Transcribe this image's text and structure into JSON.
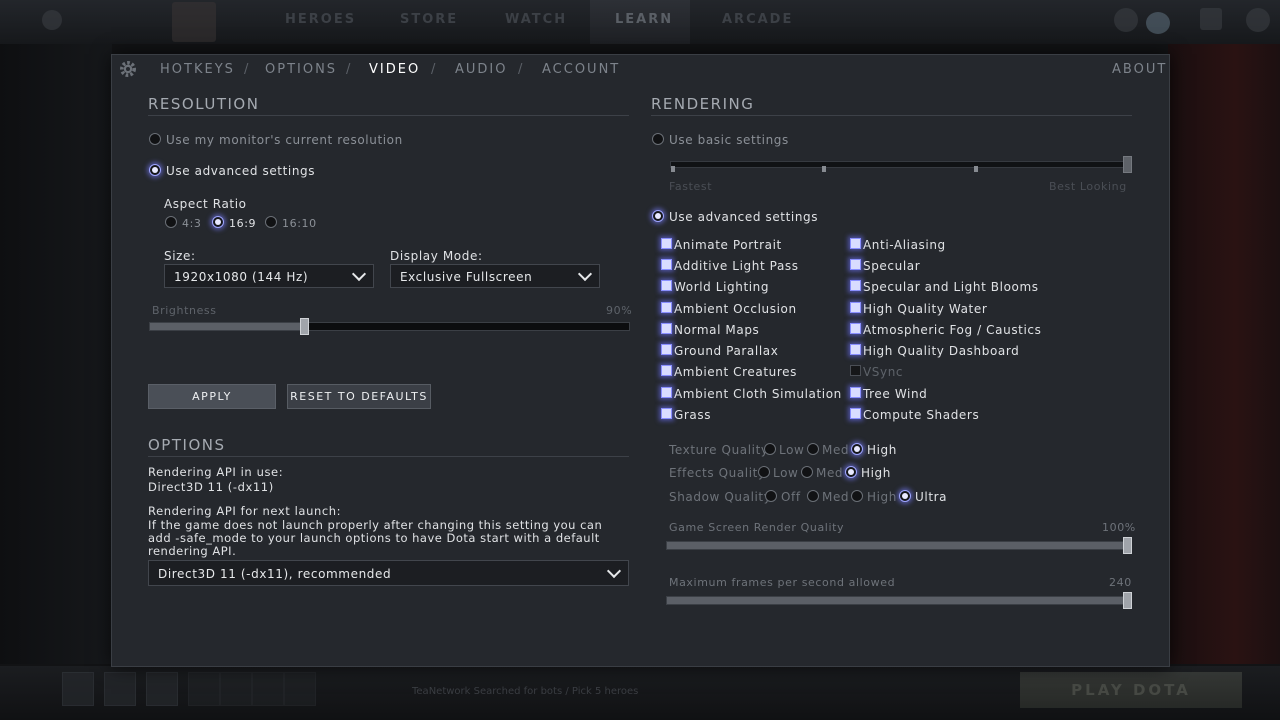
{
  "background": {
    "nav": [
      "HEROES",
      "STORE",
      "WATCH",
      "LEARN",
      "ARCADE"
    ],
    "play_label": "PLAY DOTA",
    "status_text": "TeaNetwork   Searched for bots / Pick 5 heroes"
  },
  "tabs": [
    {
      "label": "HOTKEYS"
    },
    {
      "label": "OPTIONS"
    },
    {
      "label": "VIDEO"
    },
    {
      "label": "AUDIO"
    },
    {
      "label": "ACCOUNT"
    }
  ],
  "tab_separator": "/",
  "about_label": "ABOUT",
  "resolution": {
    "title": "RESOLUTION",
    "use_monitor": "Use my monitor's current resolution",
    "use_advanced": "Use advanced settings",
    "aspect_ratio_label": "Aspect Ratio",
    "aspect_options": [
      "4:3",
      "16:9",
      "16:10"
    ],
    "aspect_selected": "16:9",
    "size_label": "Size:",
    "size_value": "1920x1080 (144 Hz)",
    "display_mode_label": "Display Mode:",
    "display_mode_value": "Exclusive Fullscreen",
    "brightness_label": "Brightness",
    "brightness_value": "90%",
    "brightness_level": 0.33,
    "apply_label": "APPLY",
    "reset_label": "RESET TO DEFAULTS"
  },
  "options": {
    "title": "OPTIONS",
    "api_in_use_label": "Rendering API in use:",
    "api_in_use_value": "Direct3D 11 (-dx11)",
    "api_next_label": "Rendering API for next launch:",
    "api_note_1": "If the game does not launch properly after changing this setting you can",
    "api_note_2": "add -safe_mode to your launch options to have Dota start with a default",
    "api_note_3": "rendering API.",
    "api_dropdown_value": "Direct3D 11 (-dx11), recommended"
  },
  "rendering": {
    "title": "RENDERING",
    "use_basic": "Use basic settings",
    "basic_min_label": "Fastest",
    "basic_max_label": "Best Looking",
    "use_advanced": "Use advanced settings",
    "left_checks": [
      {
        "label": "Animate Portrait",
        "checked": true
      },
      {
        "label": "Additive Light Pass",
        "checked": true
      },
      {
        "label": "World Lighting",
        "checked": true
      },
      {
        "label": "Ambient Occlusion",
        "checked": true
      },
      {
        "label": "Normal Maps",
        "checked": true
      },
      {
        "label": "Ground Parallax",
        "checked": true
      },
      {
        "label": "Ambient Creatures",
        "checked": true
      },
      {
        "label": "Ambient Cloth Simulation",
        "checked": true
      },
      {
        "label": "Grass",
        "checked": true
      }
    ],
    "right_checks": [
      {
        "label": "Anti-Aliasing",
        "checked": true
      },
      {
        "label": "Specular",
        "checked": true
      },
      {
        "label": "Specular and Light Blooms",
        "checked": true
      },
      {
        "label": "High Quality Water",
        "checked": true
      },
      {
        "label": "Atmospheric Fog / Caustics",
        "checked": true
      },
      {
        "label": "High Quality Dashboard",
        "checked": true
      },
      {
        "label": "VSync",
        "checked": false
      },
      {
        "label": "Tree Wind",
        "checked": true
      },
      {
        "label": "Compute Shaders",
        "checked": true
      }
    ],
    "texture_quality": {
      "label": "Texture Quality",
      "options": [
        "Low",
        "Med",
        "High"
      ],
      "selected": "High"
    },
    "effects_quality": {
      "label": "Effects Quality",
      "options": [
        "Low",
        "Med",
        "High"
      ],
      "selected": "High"
    },
    "shadow_quality": {
      "label": "Shadow Quality",
      "options": [
        "Off",
        "Med",
        "High",
        "Ultra"
      ],
      "selected": "Ultra"
    },
    "render_quality_label": "Game Screen Render Quality",
    "render_quality_value": "100%",
    "render_quality_level": 1.0,
    "max_fps_label": "Maximum frames per second allowed",
    "max_fps_value": "240",
    "max_fps_level": 1.0
  },
  "colors": {
    "panel_bg": "#25282d",
    "accent_glow": "#8a8fff"
  }
}
